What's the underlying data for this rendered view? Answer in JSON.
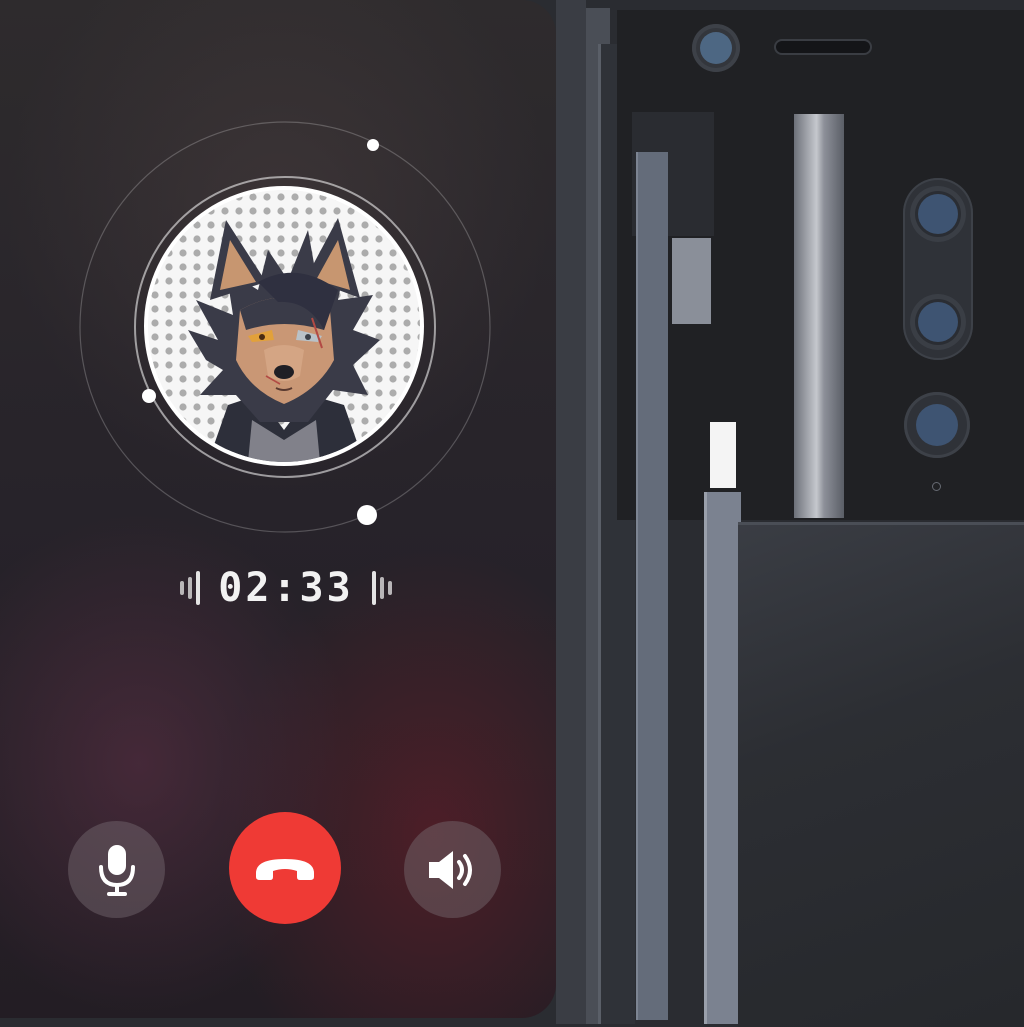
{
  "call": {
    "timer": "02:33",
    "controls": {
      "mute_icon": "microphone-icon",
      "end_icon": "phone-hangup-icon",
      "speaker_icon": "speaker-icon"
    }
  },
  "colors": {
    "end_button": "#ef3a35",
    "control_button": "#6e6469",
    "timer_text": "#f2f2f2"
  },
  "avatar": {
    "subject": "wolf-character-avatar"
  }
}
